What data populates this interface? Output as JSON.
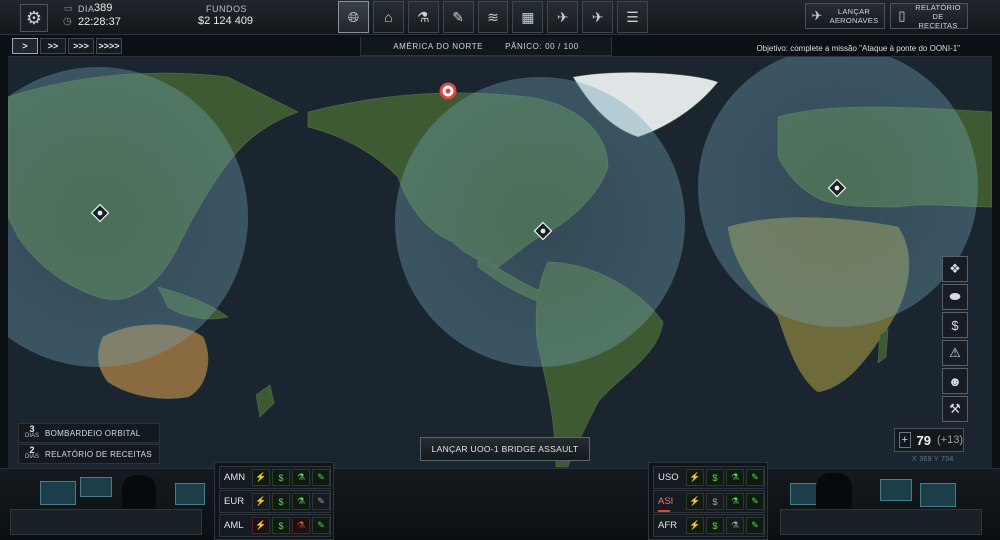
{
  "header": {
    "day_label": "DIA",
    "day_value": "389",
    "time": "22:28:37",
    "funds_label": "FUNDOS",
    "funds_value": "$2 124 409",
    "nav_icons": [
      "globe-icon",
      "hangar-icon",
      "research-icon",
      "engineering-icon",
      "barracks-icon",
      "facilities-icon",
      "weapons-icon",
      "aircraft-icon",
      "report-icon"
    ],
    "launch_aircraft_label": "LANÇAR AERONAVES",
    "income_report_label": "RELATÓRIO DE RECEITAS"
  },
  "speed_controls": [
    ">",
    ">>",
    ">>>",
    ">>>>"
  ],
  "region": {
    "name": "AMÉRICA DO NORTE",
    "panic_label": "PÂNICO:",
    "panic_value": "00 / 100"
  },
  "objective": "Objetivo: complete a missão \"Ataque à ponte do OONI-1\"",
  "events": [
    {
      "days": "3",
      "days_label": "DIAS",
      "title": "BOMBARDEIO ORBITAL"
    },
    {
      "days": "2",
      "days_label": "DIAS",
      "title": "RELATÓRIO DE RECEITAS"
    }
  ],
  "launch_button": "LANÇAR UOO-1 BRIDGE ASSAULT",
  "credits": {
    "value": "79",
    "delta": "(+13)"
  },
  "coords": "X 369   Y 704",
  "right_icons": [
    "crystals-icon",
    "capsules-icon",
    "money-icon",
    "warning-icon",
    "scientist-icon",
    "crane-icon"
  ],
  "regions_left": [
    {
      "name": "AMN",
      "status": "normal",
      "icons": [
        "g",
        "g",
        "g",
        "g"
      ]
    },
    {
      "name": "EUR",
      "status": "normal",
      "icons": [
        "n",
        "g",
        "g",
        "n"
      ]
    },
    {
      "name": "AML",
      "status": "normal",
      "icons": [
        "r",
        "g",
        "r",
        "g"
      ]
    }
  ],
  "regions_right": [
    {
      "name": "USO",
      "status": "normal",
      "icons": [
        "g",
        "g",
        "g",
        "g"
      ]
    },
    {
      "name": "ASI",
      "status": "alert",
      "icons": [
        "g",
        "n",
        "g",
        "g"
      ]
    },
    {
      "name": "AFR",
      "status": "normal",
      "icons": [
        "g",
        "g",
        "n",
        "g"
      ]
    }
  ],
  "colors": {
    "ocean": "#1b2530",
    "land": "#3c5a34",
    "coverage": "#7fb3c5",
    "alert_red": "#e0443c",
    "status_green": "#5fd35f"
  }
}
